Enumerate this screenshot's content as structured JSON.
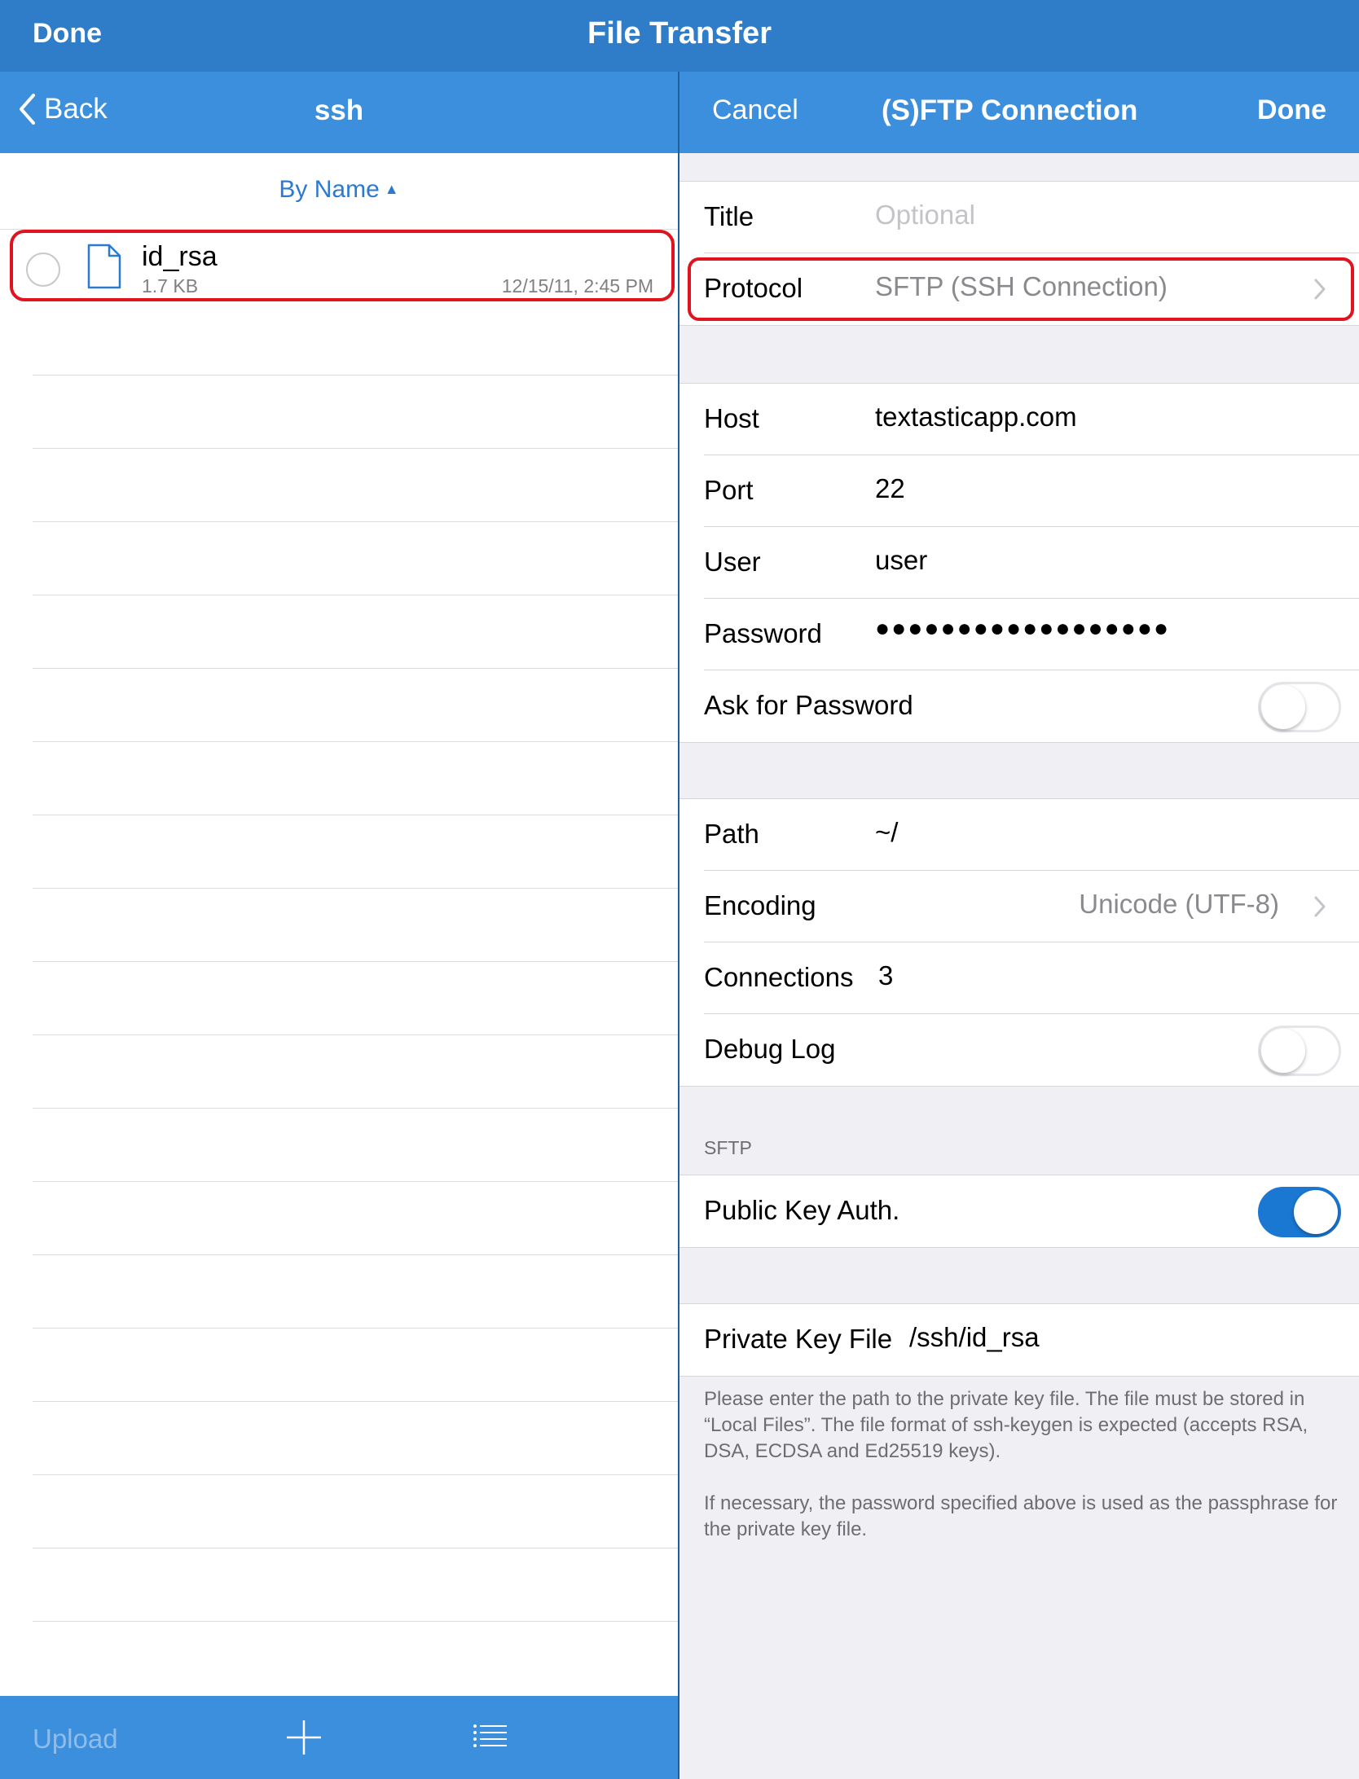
{
  "app": {
    "done_label": "Done",
    "title": "File Transfer"
  },
  "browser": {
    "back_label": "Back",
    "folder_title": "ssh",
    "sort_label": "By Name",
    "sort_arrow": "▲",
    "files": [
      {
        "name": "id_rsa",
        "size": "1.7 KB",
        "date": "12/15/11, 2:45 PM",
        "icon": "document-icon"
      }
    ],
    "toolbar": {
      "upload_label": "Upload",
      "add_icon": "plus-icon",
      "list_icon": "list-icon"
    }
  },
  "connection": {
    "cancel_label": "Cancel",
    "title": "(S)FTP Connection",
    "done_label": "Done",
    "title_label": "Title",
    "title_placeholder": "Optional",
    "protocol_label": "Protocol",
    "protocol_value": "SFTP (SSH Connection)",
    "host_label": "Host",
    "host_value": "textasticapp.com",
    "port_label": "Port",
    "port_value": "22",
    "user_label": "User",
    "user_value": "user",
    "password_label": "Password",
    "password_mask": "●●●●●●●●●●●●●●●●●●",
    "ask_password_label": "Ask for Password",
    "ask_password_on": false,
    "path_label": "Path",
    "path_value": "~/",
    "encoding_label": "Encoding",
    "encoding_value": "Unicode (UTF-8)",
    "connections_label": "Connections",
    "connections_value": "3",
    "debug_log_label": "Debug Log",
    "debug_log_on": false,
    "sftp_section_header": "SFTP",
    "public_key_label": "Public Key Auth.",
    "public_key_on": true,
    "private_key_label": "Private Key File",
    "private_key_value": "/ssh/id_rsa",
    "footer_1": "Please enter the path to the private key file. The file must be stored in “Local Files”. The file format of ssh-keygen is expected (accepts RSA, DSA, ECDSA and Ed25519 keys).",
    "footer_2": "If necessary, the password specified above is used as the passphrase for the private key file."
  },
  "colors": {
    "top_bar": "#2f7cc8",
    "nav_bar": "#3c8fdc",
    "accent": "#1a77d2",
    "highlight": "#e0131e"
  }
}
